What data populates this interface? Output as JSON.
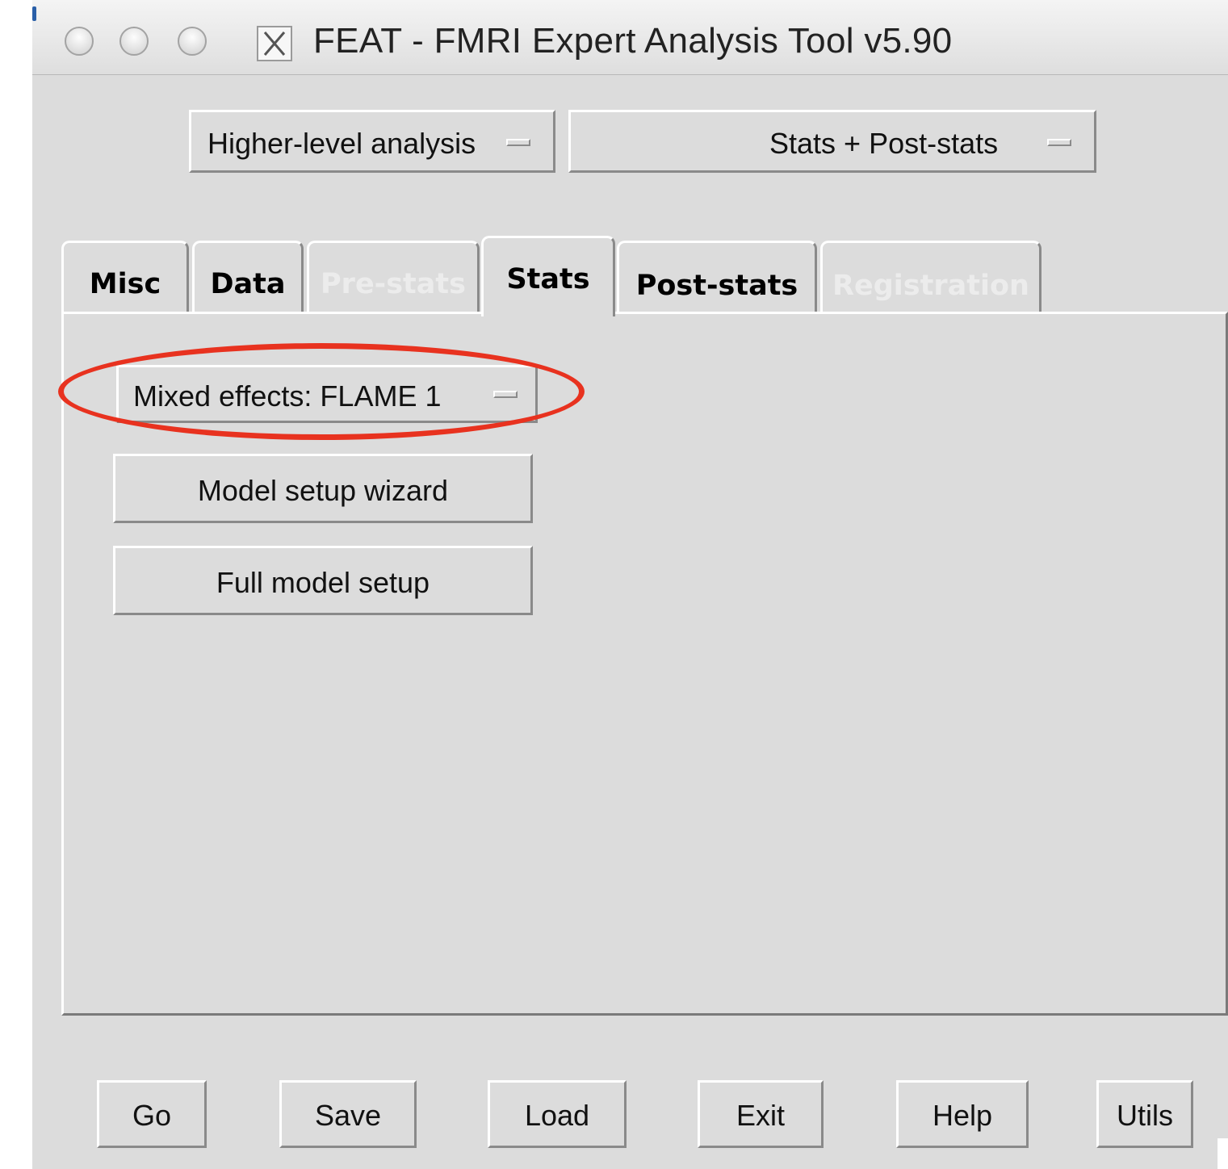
{
  "window": {
    "title": "FEAT - FMRI Expert Analysis Tool v5.90",
    "icons": [
      "traffic-light-close",
      "traffic-light-minimize",
      "traffic-light-zoom",
      "x11-icon"
    ]
  },
  "top_menus": {
    "analysis_level": "Higher-level analysis",
    "stages": "Stats + Post-stats"
  },
  "tabs": [
    {
      "label": "Misc",
      "state": "normal"
    },
    {
      "label": "Data",
      "state": "normal"
    },
    {
      "label": "Pre-stats",
      "state": "disabled"
    },
    {
      "label": "Stats",
      "state": "active"
    },
    {
      "label": "Post-stats",
      "state": "normal"
    },
    {
      "label": "Registration",
      "state": "disabled"
    }
  ],
  "stats_panel": {
    "mixed_effects_menu": "Mixed effects: FLAME 1",
    "model_wizard_button": "Model setup wizard",
    "full_model_button": "Full model setup"
  },
  "bottom_buttons": {
    "go": "Go",
    "save": "Save",
    "load": "Load",
    "exit": "Exit",
    "help": "Help",
    "utils": "Utils"
  },
  "colors": {
    "window_bg": "#dcdcdc",
    "highlight": "#e8321f",
    "disabled_text": "#ececec"
  }
}
